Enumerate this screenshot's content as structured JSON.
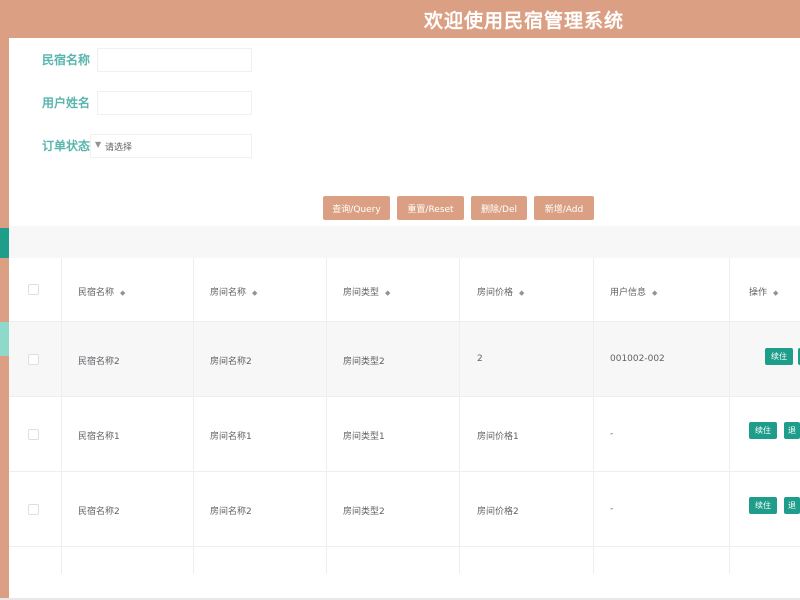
{
  "header": {
    "title": "欢迎使用民宿管理系统"
  },
  "search": {
    "homestay_name_label": "民宿名称",
    "homestay_name_value": "",
    "user_name_label": "用户姓名",
    "user_name_value": "",
    "order_status_label": "订单状态",
    "order_status_placeholder": "请选择"
  },
  "actions": {
    "query": "查询/Query",
    "reset": "重置/Reset",
    "delete": "删除/Del",
    "add": "新增/Add"
  },
  "table": {
    "columns": [
      "民宿名称",
      "房间名称",
      "房间类型",
      "房间价格",
      "用户信息",
      "操作"
    ],
    "rows": [
      {
        "homestay": "民宿名称2",
        "room": "房间名称2",
        "type": "房间类型2",
        "price": "2",
        "user": "001002-002",
        "action_primary": "续住",
        "action_secondary": ""
      },
      {
        "homestay": "民宿名称1",
        "room": "房间名称1",
        "type": "房间类型1",
        "price": "房间价格1",
        "user": "-",
        "action_primary": "续住",
        "action_secondary": "退"
      },
      {
        "homestay": "民宿名称2",
        "room": "房间名称2",
        "type": "房间类型2",
        "price": "房间价格2",
        "user": "-",
        "action_primary": "续住",
        "action_secondary": "退"
      }
    ]
  },
  "icons": {
    "sort": "sort-icon",
    "caret": "chevron-down-icon"
  },
  "colors": {
    "brand": "#dba083",
    "accent": "#1e9e8a",
    "label": "#5ab5ad"
  }
}
